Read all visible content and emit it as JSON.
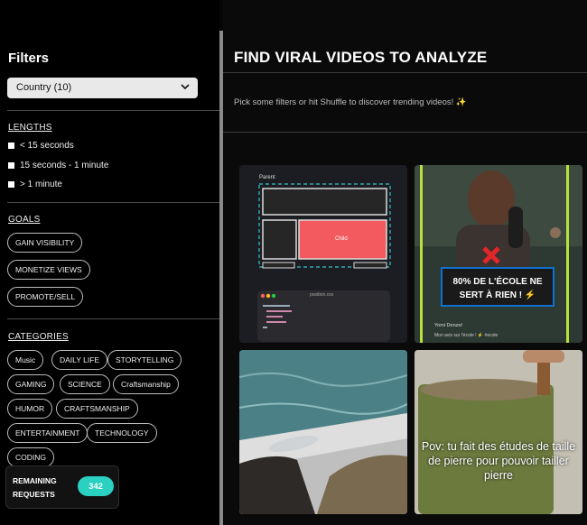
{
  "sidebar": {
    "title": "Filters",
    "country_select": "Country (10)",
    "sections": {
      "lengths": "LENGTHS",
      "goals": "GOALS",
      "categories": "CATEGORIES"
    },
    "lengths": [
      "< 15 seconds",
      "15 seconds - 1 minute",
      "> 1 minute"
    ],
    "goals": [
      "GAIN VISIBILITY",
      "MONETIZE VIEWS",
      "PROMOTE/SELL"
    ],
    "categories": [
      "Music",
      "DAILY LIFE",
      "STORYTELLING",
      "GAMING",
      "SCIENCE",
      "Craftsmanship",
      "HUMOR",
      "CRAFTSMANSHIP",
      "ENTERTAINMENT",
      "TECHNOLOGY",
      "CODING"
    ],
    "remaining": {
      "label_1": "REMAINING",
      "label_2": "REQUESTS",
      "count": "342"
    }
  },
  "main": {
    "title": "FIND VIRAL VIDEOS TO ANALYZE",
    "hint": "Pick some filters or hit Shuffle to discover trending videos! ✨",
    "videos": {
      "v1": {
        "parent_label": "Parent",
        "child_label": "Child",
        "file_label": "position.css"
      },
      "v2": {
        "caption": "80% DE L'ÉCOLE NE SERT À RIEN ! ⚡",
        "author": "Yomi Denzel",
        "desc": "Mon avis sur l'école ! ⚡ #ecole"
      },
      "v4": {
        "overlay": "Pov: tu fait des études de taille de pierre pour pouvoir tailler pierre"
      }
    }
  },
  "colors": {
    "accent": "#2ad0c0",
    "select_bg": "#e9e9e9",
    "caption_border": "#0f70d0"
  }
}
